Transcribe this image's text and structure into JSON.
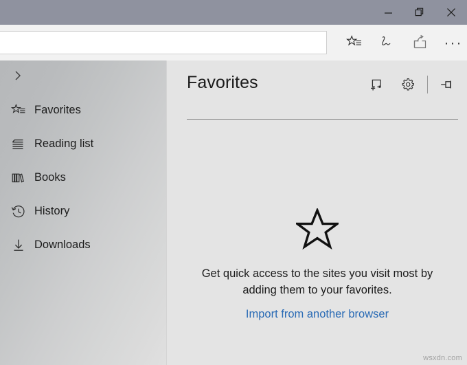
{
  "window": {
    "titlebar_color": "#8f929f",
    "controls": [
      {
        "name": "minimize",
        "label": "Minimize"
      },
      {
        "name": "restore",
        "label": "Restore Down"
      },
      {
        "name": "close",
        "label": "Close"
      }
    ]
  },
  "toolbar": {
    "address": {
      "value": "",
      "placeholder": ""
    },
    "actions": [
      {
        "name": "favorites-reading-list",
        "label": "Add to favorites or reading list"
      },
      {
        "name": "web-note",
        "label": "Make a Web Note"
      },
      {
        "name": "share",
        "label": "Share"
      },
      {
        "name": "more",
        "label": "Settings and more",
        "glyph": "···"
      }
    ]
  },
  "sidebar": {
    "toggle_label": "Expand",
    "items": [
      {
        "label": "Favorites",
        "icon": "favorites-star-icon"
      },
      {
        "label": "Reading list",
        "icon": "reading-list-icon"
      },
      {
        "label": "Books",
        "icon": "books-icon"
      },
      {
        "label": "History",
        "icon": "history-clock-icon"
      },
      {
        "label": "Downloads",
        "icon": "downloads-arrow-icon"
      }
    ]
  },
  "hub": {
    "title": "Favorites",
    "actions": [
      {
        "name": "add-folder",
        "label": "Create new folder"
      },
      {
        "name": "settings",
        "label": "Settings"
      },
      {
        "name": "pin",
        "label": "Pin this pane"
      }
    ],
    "empty_state": {
      "icon": "star-outline-icon",
      "message": "Get quick access to the sites you visit most by adding them to your favorites.",
      "link_label": "Import from another browser",
      "link_color": "#2a6bb5"
    }
  },
  "watermark": {
    "text": "wsxdn.com"
  }
}
